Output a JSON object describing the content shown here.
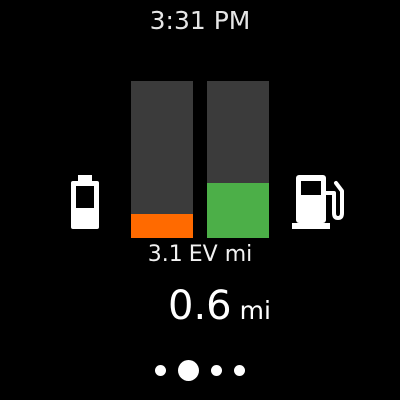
{
  "status_bar": {
    "time": "3:31 PM"
  },
  "ev": {
    "range_value": "3.1",
    "range_unit": "EV mi",
    "battery_level": 0.15
  },
  "fuel": {
    "range_value": "0.6",
    "range_unit": "mi",
    "fuel_level": 0.35
  },
  "icons": {
    "left": "battery-icon",
    "right": "fuel-pump-icon"
  },
  "pager": {
    "page_count": 4,
    "current_page": 2
  },
  "colors": {
    "background": "#000000",
    "battery_fill": "#ff6a00",
    "fuel_fill": "#4caf48",
    "bar_track": "#3b3b3b"
  }
}
